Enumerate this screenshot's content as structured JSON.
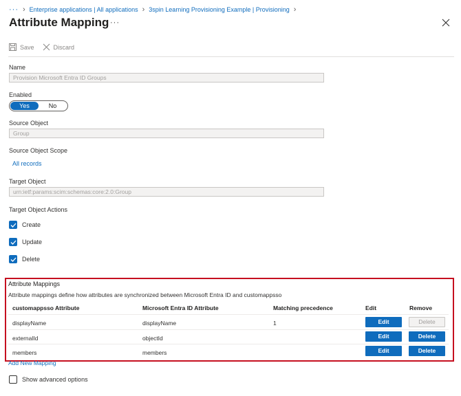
{
  "breadcrumb": {
    "items": [
      "Enterprise applications | All applications",
      "3spin Learning Provisioning Example | Provisioning"
    ]
  },
  "title": "Attribute Mapping",
  "toolbar": {
    "save": "Save",
    "discard": "Discard"
  },
  "name": {
    "label": "Name",
    "value": "Provision Microsoft Entra ID Groups"
  },
  "enabled": {
    "label": "Enabled",
    "yes": "Yes",
    "no": "No",
    "selected": "Yes"
  },
  "source_object": {
    "label": "Source Object",
    "value": "Group"
  },
  "source_scope": {
    "label": "Source Object Scope",
    "link": "All records"
  },
  "target_object": {
    "label": "Target Object",
    "value": "urn:ietf:params:scim:schemas:core:2.0:Group"
  },
  "target_actions": {
    "label": "Target Object Actions",
    "items": [
      "Create",
      "Update",
      "Delete"
    ]
  },
  "mappings": {
    "title": "Attribute Mappings",
    "description": "Attribute mappings define how attributes are synchronized between Microsoft Entra ID and customappsso",
    "headers": [
      "customappsso Attribute",
      "Microsoft Entra ID Attribute",
      "Matching precedence",
      "Edit",
      "Remove"
    ],
    "rows": [
      {
        "target": "displayName",
        "source": "displayName",
        "precedence": "1",
        "edit": "Edit",
        "remove": "Delete",
        "remove_disabled": true
      },
      {
        "target": "externalId",
        "source": "objectId",
        "precedence": "",
        "edit": "Edit",
        "remove": "Delete",
        "remove_disabled": false
      },
      {
        "target": "members",
        "source": "members",
        "precedence": "",
        "edit": "Edit",
        "remove": "Delete",
        "remove_disabled": false
      }
    ],
    "add_link": "Add New Mapping"
  },
  "advanced": {
    "label": "Show advanced options",
    "checked": false
  },
  "colors": {
    "accent": "#0f6cbd",
    "highlight_border": "#c50f1f"
  }
}
